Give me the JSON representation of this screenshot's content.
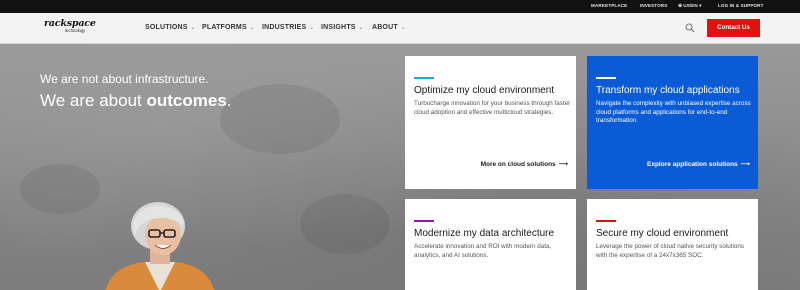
{
  "utility_bar": {
    "marketplace": "MARKETPLACE",
    "investors": "INVESTORS",
    "locale": "US/EN",
    "login": "LOG IN & SUPPORT"
  },
  "logo": {
    "word": "rackspace",
    "sub": "technology"
  },
  "nav": {
    "items": [
      {
        "label": "SOLUTIONS"
      },
      {
        "label": "PLATFORMS"
      },
      {
        "label": "INDUSTRIES"
      },
      {
        "label": "INSIGHTS"
      },
      {
        "label": "ABOUT"
      }
    ],
    "contact_label": "Contact Us"
  },
  "hero": {
    "line1": "We are not about infrastructure.",
    "line2_prefix": "We are about ",
    "line2_bold": "outcomes",
    "line2_suffix": "."
  },
  "cards": [
    {
      "title": "Optimize my cloud environment",
      "body": "Turbocharge innovation for your business through faster cloud adoption and effective multicloud strategies.",
      "link": "More on cloud solutions",
      "accent": "#14b4c8"
    },
    {
      "title": "Transform my cloud applications",
      "body": "Navigate the complexity with unbiased expertise across cloud platforms and applications for end-to-end transformation.",
      "link": "Explore application solutions",
      "accent": "#ffffff"
    },
    {
      "title": "Modernize my data architecture",
      "body": "Accelerate innovation and ROI with modern data, analytics, and AI solutions.",
      "accent": "#8b1a9e"
    },
    {
      "title": "Secure my cloud environment",
      "body": "Leverage the power of cloud native security solutions with the expertise of a 24x7x365 SOC.",
      "accent": "#e1110d"
    }
  ],
  "colors": {
    "brand_red": "#e1110d",
    "card_blue": "#0b5bd6"
  }
}
